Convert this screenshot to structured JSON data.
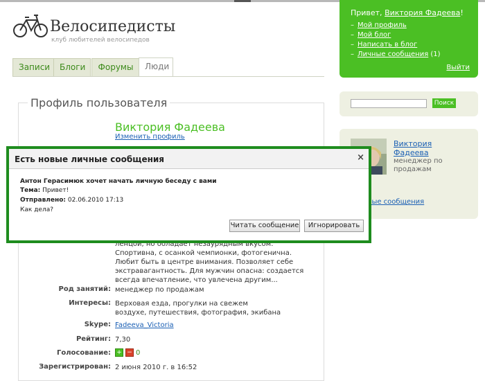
{
  "header": {
    "site_title": "Велосипедисты",
    "site_subtitle": "клуб любителей велосипедов"
  },
  "tabs": [
    {
      "label": "Записи"
    },
    {
      "label": "Блоги"
    },
    {
      "label": "Форумы"
    },
    {
      "label": "Люди",
      "active": true
    }
  ],
  "userbox": {
    "greeting_prefix": "Привет, ",
    "user_name": "Виктория Фадеева",
    "greeting_suffix": "!",
    "links": [
      {
        "label": "Мой профиль"
      },
      {
        "label": "Мой блог"
      },
      {
        "label": "Написать в блог"
      },
      {
        "label": "Личные сообщения",
        "count": "(1)"
      }
    ],
    "logout": "Выйти"
  },
  "search": {
    "value": "",
    "button": "Поиск"
  },
  "profile_widget": {
    "name": "Виктория Фадеева",
    "role": "менеджер по продажам",
    "messages_link": "чные сообщения"
  },
  "profile": {
    "section_title": "Профиль пользователя",
    "name": "Виктория Фадеева",
    "edit_link": "Изменить профиль",
    "about": "ленцой, но обладает незаурядным вкусом. Спортивна, с осанкой чемпионки, фотогенична. Любит быть в центре внимания. Позволяет себе экстравагантность. Для мужчин опасна: создается всегда впечатление, что увлечена другим...",
    "fields": [
      {
        "label": "Род занятий:",
        "value": "менеджер по продажам"
      },
      {
        "label": "Интересы:",
        "value": "Верховая езда, прогулки на свежем воздухе, путешествия, фотография, экибана"
      },
      {
        "label": "Skype:",
        "value": "Fadeeva_Victoria"
      },
      {
        "label": "Рейтинг:",
        "value": "7,30"
      },
      {
        "label": "Голосование:",
        "value": "0"
      },
      {
        "label": "Зарегистрирован:",
        "value": "2 июня 2010 г. в 16:52"
      }
    ]
  },
  "popup": {
    "title": "Есть новые личные сообщения",
    "close": "×",
    "sender_line": "Антон Герасимюк хочет начать личную беседу с вами",
    "subject_label": "Тема:",
    "subject": "Привет!",
    "sent_label": "Отправлено:",
    "sent": "02.06.2010 17:13",
    "body": "Как дела?",
    "read_button": "Читать сообщение",
    "ignore_button": "Игнорировать"
  },
  "colors": {
    "brand_green": "#4bbf24",
    "popup_border": "#1e8c1e",
    "link": "#1a5fb4"
  }
}
